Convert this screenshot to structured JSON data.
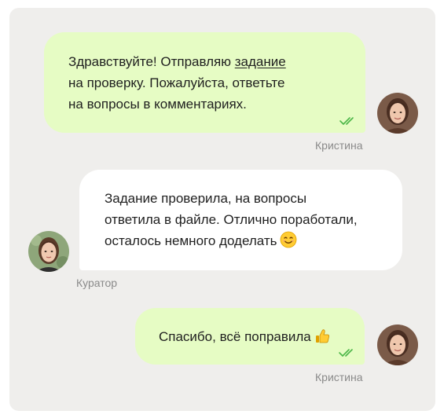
{
  "messages": [
    {
      "sender": "Кристина",
      "direction": "outgoing",
      "lines": [
        {
          "before": "Здравствуйте! Отправляю ",
          "link": "задание"
        },
        {
          "text": "на проверку. Пожалуйста, ответьте"
        },
        {
          "text": "на вопросы в комментариях."
        }
      ],
      "status": "read"
    },
    {
      "sender": "Куратор",
      "direction": "incoming",
      "lines": [
        {
          "text": "Задание проверила, на вопросы"
        },
        {
          "text": "ответила в файле. Отлично поработали,"
        },
        {
          "text": "осталось немного доделать"
        }
      ],
      "emoji": "smiling-face-icon"
    },
    {
      "sender": "Кристина",
      "direction": "outgoing",
      "lines": [
        {
          "text": "Спасибо, всё поправила"
        }
      ],
      "emoji": "thumbs-up-icon",
      "status": "read"
    }
  ],
  "colors": {
    "panel_bg": "#efeeec",
    "outgoing_bubble": "#e6fcc4",
    "incoming_bubble": "#ffffff",
    "read_check": "#4cb648",
    "sender_name": "#8a8a8a"
  }
}
